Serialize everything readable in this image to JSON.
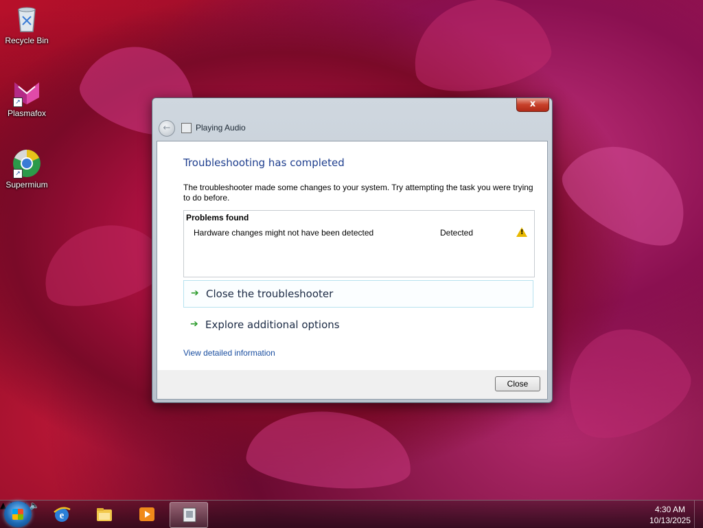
{
  "desktop": {
    "icons": [
      {
        "label": "Recycle Bin",
        "icon": "recycle-bin-icon"
      },
      {
        "label": "Plasmafox",
        "icon": "plasmafox-icon"
      },
      {
        "label": "Supermium",
        "icon": "supermium-icon"
      }
    ]
  },
  "window": {
    "title": "Playing Audio",
    "close_glyph": "x",
    "back_glyph": "←",
    "heading": "Troubleshooting has completed",
    "description": "The troubleshooter made some changes to your system. Try attempting the task you were trying to do before.",
    "problems": {
      "header": "Problems found",
      "items": [
        {
          "name": "Hardware changes might not have been detected",
          "status": "Detected",
          "icon": "warning-icon"
        }
      ]
    },
    "options": [
      {
        "label": "Close the troubleshooter",
        "icon": "green-arrow-icon"
      },
      {
        "label": "Explore additional options",
        "icon": "green-arrow-icon"
      }
    ],
    "detail_link": "View detailed information",
    "close_button": "Close"
  },
  "taskbar": {
    "items": [
      {
        "name": "internet-explorer-icon"
      },
      {
        "name": "file-explorer-icon"
      },
      {
        "name": "media-player-icon"
      },
      {
        "name": "troubleshooter-icon",
        "active": true
      }
    ],
    "clock": {
      "time": "4:30 AM",
      "date": "10/13/2025"
    },
    "colors": {
      "accent": "#1e3e8e",
      "link": "#1a4ea0",
      "warning": "#e8b800"
    }
  }
}
